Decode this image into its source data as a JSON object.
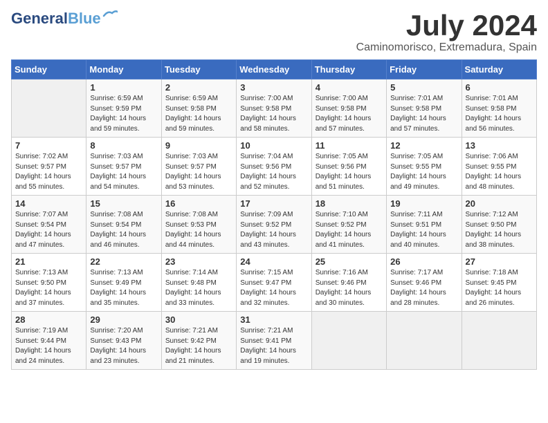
{
  "header": {
    "logo_line1": "General",
    "logo_line2": "Blue",
    "month_year": "July 2024",
    "location": "Caminomorisco, Extremadura, Spain"
  },
  "weekdays": [
    "Sunday",
    "Monday",
    "Tuesday",
    "Wednesday",
    "Thursday",
    "Friday",
    "Saturday"
  ],
  "weeks": [
    [
      {
        "day": "",
        "empty": true
      },
      {
        "day": "1",
        "sunrise": "6:59 AM",
        "sunset": "9:59 PM",
        "daylight": "14 hours and 59 minutes."
      },
      {
        "day": "2",
        "sunrise": "6:59 AM",
        "sunset": "9:58 PM",
        "daylight": "14 hours and 59 minutes."
      },
      {
        "day": "3",
        "sunrise": "7:00 AM",
        "sunset": "9:58 PM",
        "daylight": "14 hours and 58 minutes."
      },
      {
        "day": "4",
        "sunrise": "7:00 AM",
        "sunset": "9:58 PM",
        "daylight": "14 hours and 57 minutes."
      },
      {
        "day": "5",
        "sunrise": "7:01 AM",
        "sunset": "9:58 PM",
        "daylight": "14 hours and 57 minutes."
      },
      {
        "day": "6",
        "sunrise": "7:01 AM",
        "sunset": "9:58 PM",
        "daylight": "14 hours and 56 minutes."
      }
    ],
    [
      {
        "day": "7",
        "sunrise": "7:02 AM",
        "sunset": "9:57 PM",
        "daylight": "14 hours and 55 minutes."
      },
      {
        "day": "8",
        "sunrise": "7:03 AM",
        "sunset": "9:57 PM",
        "daylight": "14 hours and 54 minutes."
      },
      {
        "day": "9",
        "sunrise": "7:03 AM",
        "sunset": "9:57 PM",
        "daylight": "14 hours and 53 minutes."
      },
      {
        "day": "10",
        "sunrise": "7:04 AM",
        "sunset": "9:56 PM",
        "daylight": "14 hours and 52 minutes."
      },
      {
        "day": "11",
        "sunrise": "7:05 AM",
        "sunset": "9:56 PM",
        "daylight": "14 hours and 51 minutes."
      },
      {
        "day": "12",
        "sunrise": "7:05 AM",
        "sunset": "9:55 PM",
        "daylight": "14 hours and 49 minutes."
      },
      {
        "day": "13",
        "sunrise": "7:06 AM",
        "sunset": "9:55 PM",
        "daylight": "14 hours and 48 minutes."
      }
    ],
    [
      {
        "day": "14",
        "sunrise": "7:07 AM",
        "sunset": "9:54 PM",
        "daylight": "14 hours and 47 minutes."
      },
      {
        "day": "15",
        "sunrise": "7:08 AM",
        "sunset": "9:54 PM",
        "daylight": "14 hours and 46 minutes."
      },
      {
        "day": "16",
        "sunrise": "7:08 AM",
        "sunset": "9:53 PM",
        "daylight": "14 hours and 44 minutes."
      },
      {
        "day": "17",
        "sunrise": "7:09 AM",
        "sunset": "9:52 PM",
        "daylight": "14 hours and 43 minutes."
      },
      {
        "day": "18",
        "sunrise": "7:10 AM",
        "sunset": "9:52 PM",
        "daylight": "14 hours and 41 minutes."
      },
      {
        "day": "19",
        "sunrise": "7:11 AM",
        "sunset": "9:51 PM",
        "daylight": "14 hours and 40 minutes."
      },
      {
        "day": "20",
        "sunrise": "7:12 AM",
        "sunset": "9:50 PM",
        "daylight": "14 hours and 38 minutes."
      }
    ],
    [
      {
        "day": "21",
        "sunrise": "7:13 AM",
        "sunset": "9:50 PM",
        "daylight": "14 hours and 37 minutes."
      },
      {
        "day": "22",
        "sunrise": "7:13 AM",
        "sunset": "9:49 PM",
        "daylight": "14 hours and 35 minutes."
      },
      {
        "day": "23",
        "sunrise": "7:14 AM",
        "sunset": "9:48 PM",
        "daylight": "14 hours and 33 minutes."
      },
      {
        "day": "24",
        "sunrise": "7:15 AM",
        "sunset": "9:47 PM",
        "daylight": "14 hours and 32 minutes."
      },
      {
        "day": "25",
        "sunrise": "7:16 AM",
        "sunset": "9:46 PM",
        "daylight": "14 hours and 30 minutes."
      },
      {
        "day": "26",
        "sunrise": "7:17 AM",
        "sunset": "9:46 PM",
        "daylight": "14 hours and 28 minutes."
      },
      {
        "day": "27",
        "sunrise": "7:18 AM",
        "sunset": "9:45 PM",
        "daylight": "14 hours and 26 minutes."
      }
    ],
    [
      {
        "day": "28",
        "sunrise": "7:19 AM",
        "sunset": "9:44 PM",
        "daylight": "14 hours and 24 minutes."
      },
      {
        "day": "29",
        "sunrise": "7:20 AM",
        "sunset": "9:43 PM",
        "daylight": "14 hours and 23 minutes."
      },
      {
        "day": "30",
        "sunrise": "7:21 AM",
        "sunset": "9:42 PM",
        "daylight": "14 hours and 21 minutes."
      },
      {
        "day": "31",
        "sunrise": "7:21 AM",
        "sunset": "9:41 PM",
        "daylight": "14 hours and 19 minutes."
      },
      {
        "day": "",
        "empty": true
      },
      {
        "day": "",
        "empty": true
      },
      {
        "day": "",
        "empty": true
      }
    ]
  ]
}
